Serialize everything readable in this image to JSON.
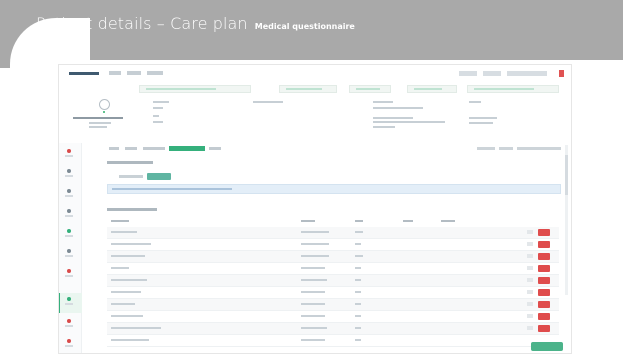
{
  "slide": {
    "title": "Patient details – Care plan",
    "subtitle": "Medical questionnaire"
  },
  "screenshot": {
    "rows_count_shown": 10
  }
}
